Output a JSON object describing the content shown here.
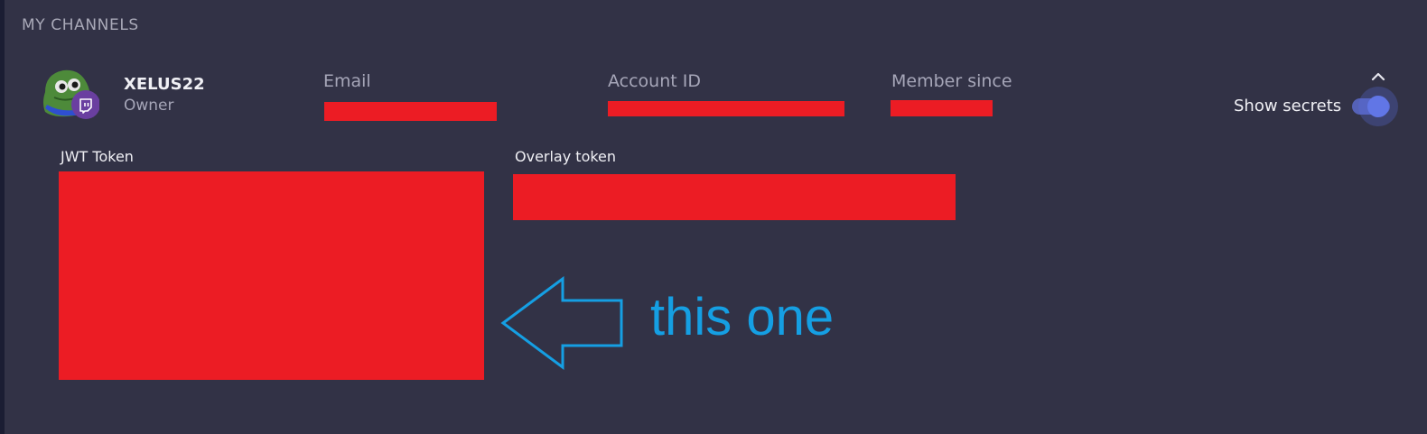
{
  "section": {
    "title": "MY CHANNELS"
  },
  "channel": {
    "name": "XELUS22",
    "role": "Owner",
    "platform_badge_icon": "twitch-icon",
    "avatar_icon": "frog-avatar"
  },
  "fields": {
    "email_label": "Email",
    "account_id_label": "Account ID",
    "member_since_label": "Member since"
  },
  "controls": {
    "show_secrets_label": "Show secrets",
    "show_secrets_on": true,
    "collapse_icon": "chevron-up-icon"
  },
  "tokens": {
    "jwt_label": "JWT Token",
    "overlay_label": "Overlay token"
  },
  "annotation": {
    "text": "this one",
    "arrow_icon": "arrow-left-outline-icon"
  },
  "colors": {
    "background": "#323246",
    "redaction": "#ec1c24",
    "toggle_accent": "#6176e6",
    "annotation": "#159fe3",
    "twitch_badge": "#6a3fa0"
  }
}
